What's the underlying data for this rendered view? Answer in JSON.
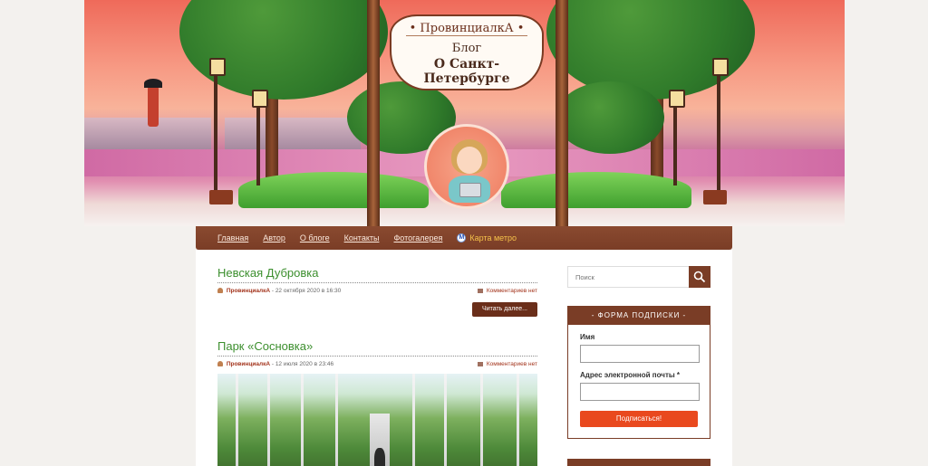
{
  "header": {
    "brand": "• ПровинциалкА •",
    "blog_line1": "Блог",
    "blog_line2": "О Санкт-Петербурге"
  },
  "nav": {
    "items": [
      "Главная",
      "Автор",
      "О блоге",
      "Контакты",
      "Фотогалерея"
    ],
    "metro_label": "Карта метро"
  },
  "posts": [
    {
      "title": "Невская Дубровка",
      "author": "ПровинциалкА",
      "date": " - 22 октября 2020 в 16:30",
      "comments": "Комментариев нет",
      "read_more": "Читать далее..."
    },
    {
      "title": "Парк «Сосновка»",
      "author": "ПровинциалкА",
      "date": " - 12 июля 2020 в 23:46",
      "comments": "Комментариев нет"
    }
  ],
  "sidebar": {
    "search_placeholder": "Поиск",
    "subscribe": {
      "title": "- Форма подписки -",
      "name_label": "Имя",
      "email_label": "Адрес электронной почты *",
      "button": "Подписаться!"
    }
  },
  "colors": {
    "nav_bg": "#7a3d26",
    "title_green": "#3c8f2e",
    "accent_red": "#e9491e",
    "link_red": "#a3341c"
  }
}
